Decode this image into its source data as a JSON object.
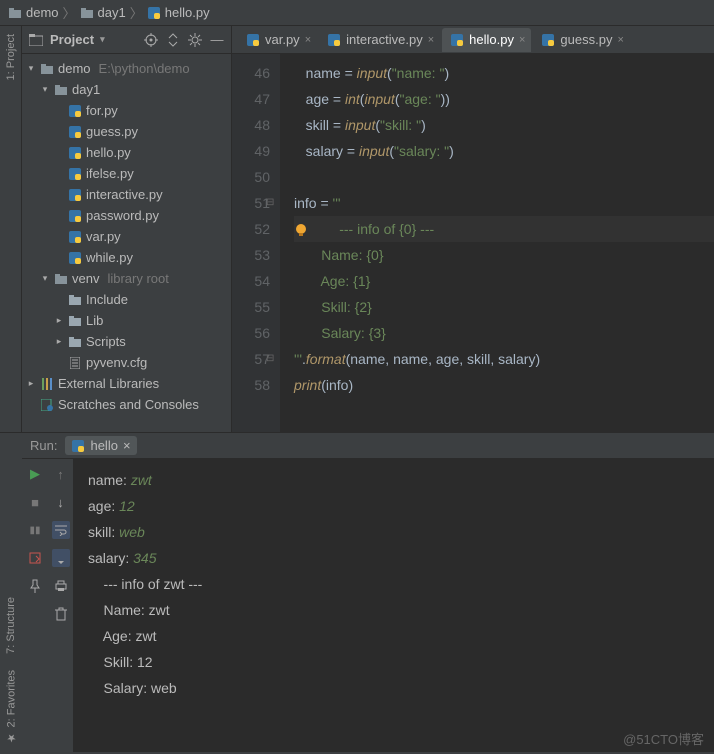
{
  "breadcrumb": [
    "demo",
    "day1",
    "hello.py"
  ],
  "project_tool": {
    "title": "Project"
  },
  "tree": {
    "root": {
      "name": "demo",
      "note": "E:\\python\\demo"
    },
    "day1": "day1",
    "files": [
      "for.py",
      "guess.py",
      "hello.py",
      "ifelse.py",
      "interactive.py",
      "password.py",
      "var.py",
      "while.py"
    ],
    "venv": {
      "name": "venv",
      "note": "library root"
    },
    "venv_children": [
      "Include",
      "Lib",
      "Scripts",
      "pyvenv.cfg"
    ],
    "extlib": "External Libraries",
    "scratch": "Scratches and Consoles"
  },
  "tabs": [
    "var.py",
    "interactive.py",
    "hello.py",
    "guess.py"
  ],
  "active_tab": 2,
  "code": {
    "start": 46,
    "lines": [
      {
        "t": [
          "name = ",
          {
            "fn": "input"
          },
          "(",
          {
            "str": "\"name: \""
          },
          ")"
        ]
      },
      {
        "t": [
          "age = ",
          {
            "fn": "int"
          },
          "(",
          {
            "fn": "input"
          },
          "(",
          {
            "str": "\"age: \""
          },
          "))"
        ]
      },
      {
        "t": [
          "skill = ",
          {
            "fn": "input"
          },
          "(",
          {
            "str": "\"skill: \""
          },
          ")"
        ]
      },
      {
        "t": [
          "salary = ",
          {
            "fn": "input"
          },
          "(",
          {
            "str": "\"salary: \""
          },
          ")"
        ]
      },
      {
        "t": [
          " "
        ]
      },
      {
        "t": [
          "info = ",
          {
            "str": "'''"
          }
        ],
        "fold": "⊟",
        "dedent": true
      },
      {
        "t": [
          {
            "str": "    --- info of {0} ---"
          }
        ],
        "bulb": true,
        "cur": true
      },
      {
        "t": [
          {
            "str": "    Name: {0}"
          }
        ]
      },
      {
        "t": [
          {
            "str": "    Age: {1}"
          }
        ]
      },
      {
        "t": [
          {
            "str": "    Skill: {2}"
          }
        ]
      },
      {
        "t": [
          {
            "str": "    Salary: {3}"
          }
        ]
      },
      {
        "t": [
          {
            "str": "'''"
          },
          ".",
          {
            "fn": "format"
          },
          "(name, name, age, skill, salary)"
        ],
        "fold": "⊟",
        "dedent": true
      },
      {
        "t": [
          {
            "fn": "print"
          },
          "(info)"
        ],
        "dedent": true
      }
    ]
  },
  "side_labels": {
    "project": "1: Project",
    "structure": "7: Structure",
    "favorites": "2: Favorites"
  },
  "run": {
    "label": "Run:",
    "config": "hello",
    "output": [
      {
        "p": "name: ",
        "v": "zwt"
      },
      {
        "p": "age: ",
        "v": "12"
      },
      {
        "p": "skill: ",
        "v": "web"
      },
      {
        "p": "salary: ",
        "v": "345"
      },
      {
        "p": ""
      },
      {
        "p": "    --- info of zwt ---"
      },
      {
        "p": "    Name: zwt"
      },
      {
        "p": "    Age: zwt"
      },
      {
        "p": "    Skill: 12"
      },
      {
        "p": "    Salary: web"
      }
    ]
  },
  "watermark": "@51CTO博客"
}
